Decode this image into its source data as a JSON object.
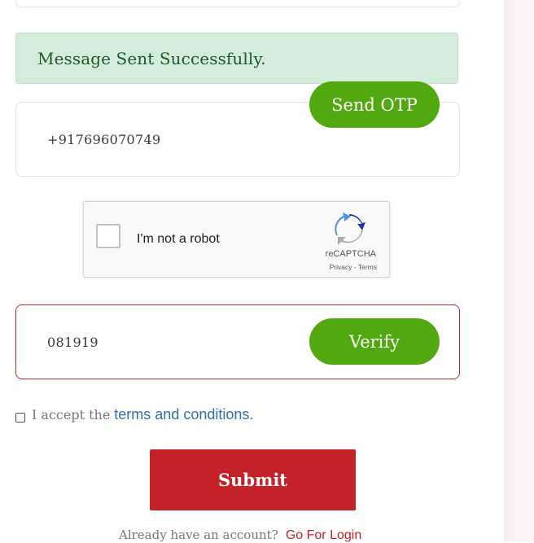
{
  "alert": {
    "message": "Message Sent Successfully."
  },
  "phone": {
    "value": "+917696070749",
    "send_otp_label": "Send OTP"
  },
  "recaptcha": {
    "label": "I'm not a robot",
    "brand": "reCAPTCHA",
    "privacy": "Privacy",
    "separator": " - ",
    "terms": "Terms"
  },
  "otp": {
    "value": "081919",
    "verify_label": "Verify"
  },
  "terms": {
    "prefix": "I accept the",
    "link": "terms and conditions."
  },
  "submit": {
    "label": "Submit"
  },
  "login": {
    "question": "Already have an account?",
    "link": "Go For Login"
  },
  "colors": {
    "accent_green": "#52a80f",
    "submit_red": "#c52128",
    "alert_bg": "#d4ecdb"
  },
  "icons": {
    "recaptcha": "recaptcha-logo-icon",
    "checkbox": "checkbox-icon"
  }
}
